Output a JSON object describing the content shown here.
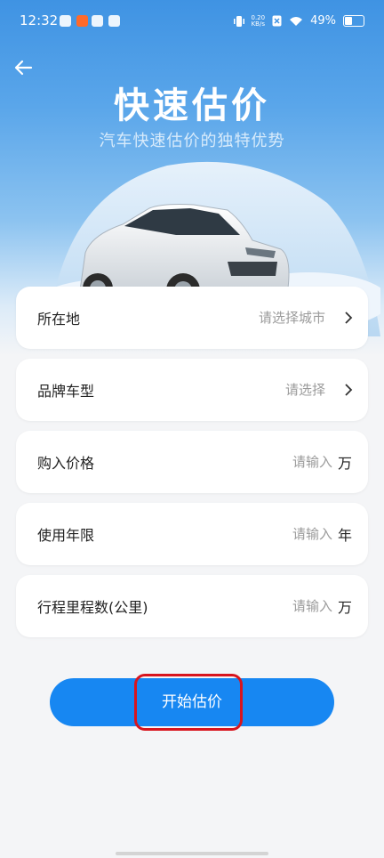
{
  "status_bar": {
    "time": "12:32",
    "net_rate": "0.20",
    "net_rate_unit": "KB/s",
    "battery": "49%"
  },
  "header": {
    "title": "快速估价",
    "subtitle": "汽车快速估价的独特优势"
  },
  "form": {
    "fields": [
      {
        "label": "所在地",
        "placeholder": "请选择城市"
      },
      {
        "label": "品牌车型",
        "placeholder": "请选择"
      },
      {
        "label": "购入价格",
        "placeholder": "请输入",
        "unit": "万"
      },
      {
        "label": "使用年限",
        "placeholder": "请输入",
        "unit": "年"
      },
      {
        "label": "行程里程数(公里)",
        "placeholder": "请输入",
        "unit": "万"
      }
    ]
  },
  "actions": {
    "start_label": "开始估价"
  },
  "colors": {
    "primary": "#1787f2",
    "highlight": "#d8151e",
    "hero_top": "#3f93e3"
  }
}
